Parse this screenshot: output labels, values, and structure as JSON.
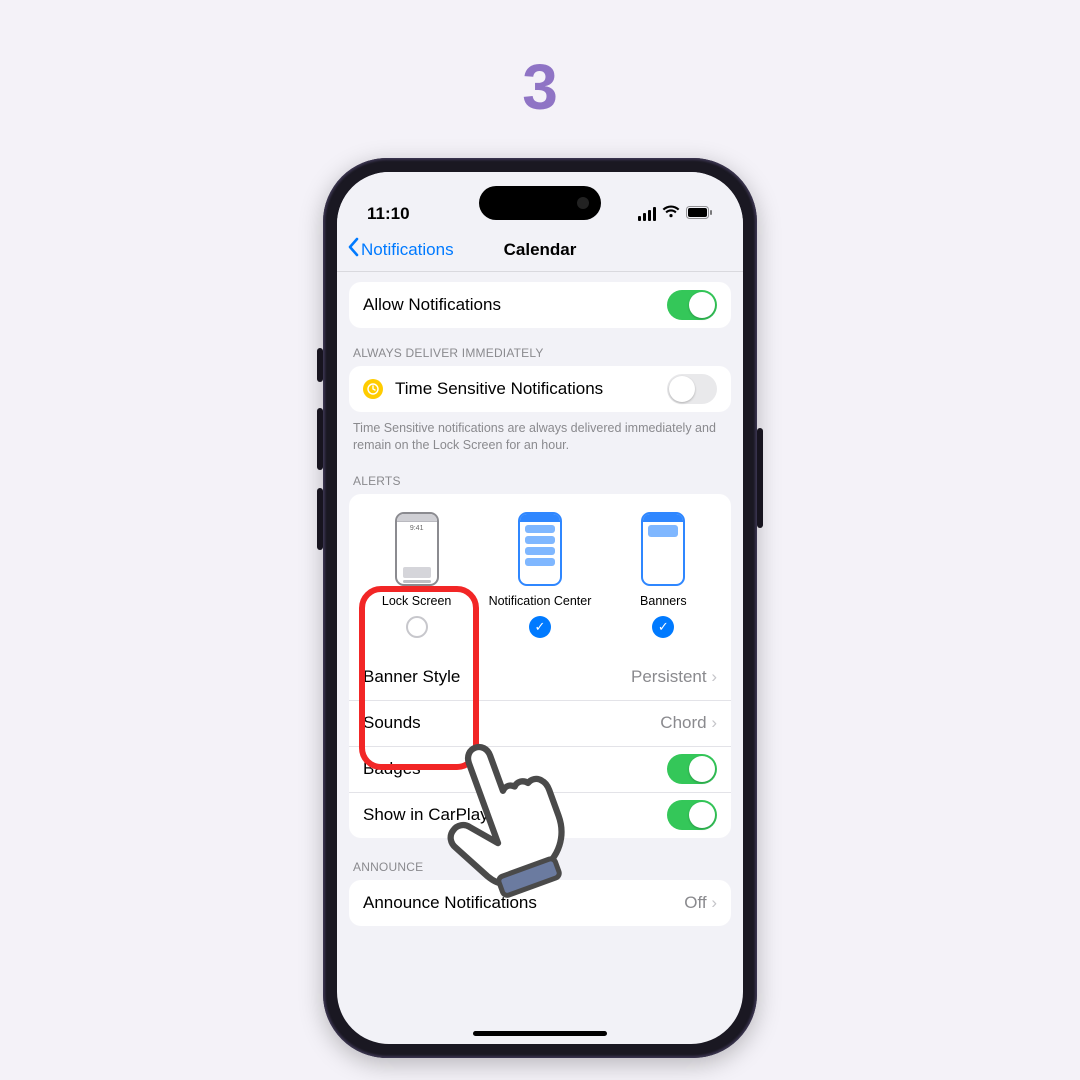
{
  "step_number": "3",
  "status": {
    "time": "11:10"
  },
  "nav": {
    "back": "Notifications",
    "title": "Calendar"
  },
  "rows": {
    "allow": "Allow Notifications",
    "timesensitive": "Time Sensitive Notifications",
    "bannerstyle_label": "Banner Style",
    "bannerstyle_value": "Persistent",
    "sounds_label": "Sounds",
    "sounds_value": "Chord",
    "badges": "Badges",
    "carplay": "Show in CarPlay",
    "announce_label": "Announce Notifications",
    "announce_value": "Off"
  },
  "sections": {
    "deliver": "ALWAYS DELIVER IMMEDIATELY",
    "deliver_footer": "Time Sensitive notifications are always delivered immediately and remain on the Lock Screen for an hour.",
    "alerts": "ALERTS",
    "announce": "ANNOUNCE"
  },
  "alerts": {
    "lock": "Lock Screen",
    "nc": "Notification Center",
    "banners": "Banners",
    "lock_time": "9:41"
  }
}
